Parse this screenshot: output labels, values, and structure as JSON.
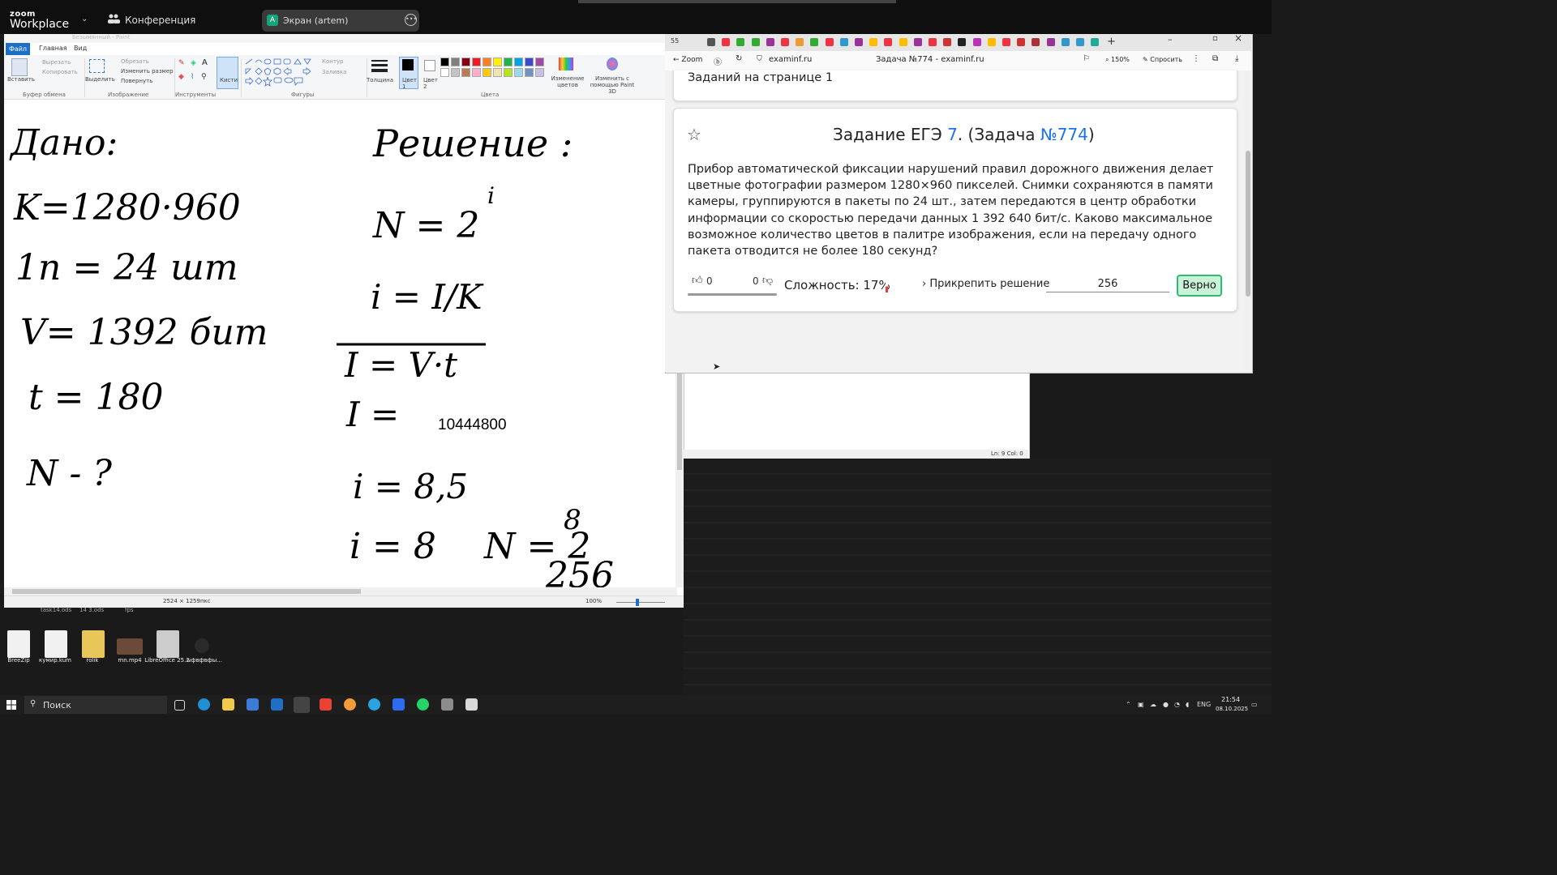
{
  "zoom": {
    "logo_top": "zoom",
    "logo_bottom": "Workplace",
    "conference_label": "Конференция",
    "screen_share_badge": "A",
    "screen_share_label": "Экран (artem)"
  },
  "paint": {
    "tabs": [
      "Файл",
      "Главная",
      "Вид"
    ],
    "title_faint": "Безымянный - Paint",
    "clipboard": {
      "paste": "Вставить",
      "cut": "Вырезать",
      "copy": "Копировать",
      "group": "Буфер обмена"
    },
    "image": {
      "select": "Выделить",
      "crop": "Обрезать",
      "resize": "Изменить размер",
      "rotate": "Повернуть",
      "group": "Изображение"
    },
    "tools": {
      "brushes": "Кисти",
      "group": "Инструменты"
    },
    "shapes": {
      "outline": "Контур",
      "fill": "Заливка",
      "group": "Фигуры"
    },
    "thickness": "Толщина",
    "color1": "Цвет 1",
    "color2": "Цвет 2",
    "edit_colors": "Изменение цветов",
    "paint3d": "Изменить с помощью Paint 3D",
    "colors_group": "Цвета",
    "palette": [
      "#000000",
      "#7f7f7f",
      "#880015",
      "#ed1c24",
      "#ff7f27",
      "#fff200",
      "#22b14c",
      "#00a2e8",
      "#3f48cc",
      "#a349a4",
      "#ffffff",
      "#c3c3c3",
      "#b97a57",
      "#ffaec9",
      "#ffc90e",
      "#efe4b0",
      "#b5e61d",
      "#99d9ea",
      "#7092be",
      "#c8bfe7"
    ],
    "status_size": "2524 × 1259пкс",
    "status_zoom": "100%",
    "canvas_typed_number": "10444800",
    "handwriting": {
      "given": "Дано:",
      "k": "K=1280·960",
      "n1": "1п = 24 шт",
      "v": "V= 1392 бит",
      "t": "t = 180",
      "n_q": "N - ?",
      "solution": "Решение :",
      "n_eq": "N = 2",
      "n_exp": "i",
      "i_eq": "i = I/K",
      "I_eq": "I = V·t",
      "I_res": "I =",
      "i_85": "i = 8,5",
      "i_8": "i = 8",
      "N_final": "N = 2",
      "N_final_exp": "8",
      "N_result": "256"
    }
  },
  "notepad": {
    "status": "Ln: 9   Col: 0"
  },
  "browser": {
    "tab_count": "55",
    "zoom_back": "Zoom",
    "url": "examinf.ru",
    "page_title": "Задача №774 - examinf.ru",
    "zoom_level": "150%",
    "ask": "Спросить",
    "tasks_on_page": "Заданий на странице 1",
    "task_heading_prefix": "Задание ЕГЭ",
    "task_number_link": "7",
    "task_heading_mid": ". (Задача",
    "task_id_link": "№774",
    "task_heading_suffix": ")",
    "task_text": "Прибор автоматической фиксации нарушений правил дорожного движения делает цветные фотографии размером 1280×960 пикселей. Снимки сохраняются в памяти камеры, группируются в пакеты по 24 шт., затем передаются в центр обработки информации со скоростью передачи данных 1 392 640 бит/с. Каково максимальное возможное количество цветов в палитре изображения, если на передачу одного пакета отводится не более 180 секунд?",
    "likes": "0",
    "dislikes": "0",
    "difficulty": "Сложность: 17%",
    "attach_solution": "Прикрепить решение",
    "answer_value": "256",
    "check_result": "Верно"
  },
  "desktop": {
    "faint_labels": [
      "task14.ods",
      "14 3.ods",
      "fps"
    ],
    "icons": [
      "BreeZip",
      "кумир.kum",
      "rolik",
      "mn.mp4",
      "LibreOffice 25.2",
      "ыфвфвфы..."
    ]
  },
  "taskbar": {
    "search_placeholder": "Поиск",
    "lang": "ENG",
    "time": "21:54",
    "date": "08.10.2025"
  },
  "colors": {
    "link_blue": "#1a73e8",
    "success_green": "#2dbd6e",
    "paint_file_tab": "#1a6fc9",
    "zoom_bar": "#0f0f0f"
  }
}
